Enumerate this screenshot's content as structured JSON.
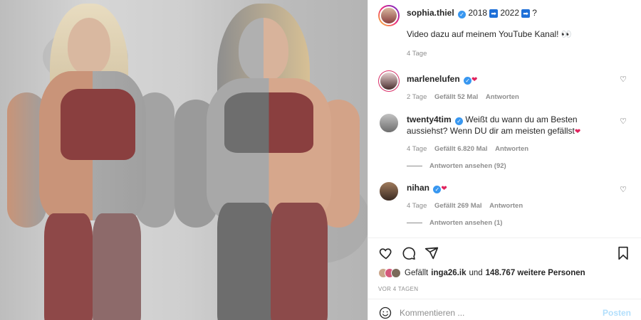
{
  "post": {
    "author": "sophia.thiel",
    "caption_text_1": "2018",
    "caption_text_2": "2022",
    "caption_text_3": "?",
    "caption_arrow": "➡",
    "caption_line2": "Video dazu auf meinem YouTube Kanal! 👀",
    "age": "4 Tage"
  },
  "comments": [
    {
      "username": "marlenelufen",
      "text": "",
      "age": "2 Tage",
      "likes": "Gefällt 52 Mal",
      "reply_label": "Antworten",
      "view_replies": ""
    },
    {
      "username": "twenty4tim",
      "text": "Weißt du wann du am Besten aussiehst? Wenn DU dir am meisten gefällst",
      "age": "4 Tage",
      "likes": "Gefällt 6.820 Mal",
      "reply_label": "Antworten",
      "view_replies": "Antworten ansehen (92)"
    },
    {
      "username": "nihan",
      "text": "",
      "age": "4 Tage",
      "likes": "Gefällt 269 Mal",
      "reply_label": "Antworten",
      "view_replies": "Antworten ansehen (1)"
    }
  ],
  "likes": {
    "prefix": "Gefällt",
    "user": "inga26.ik",
    "connector": "und",
    "count_text": "148.767 weitere Personen"
  },
  "timestamp": "VOR 4 TAGEN",
  "composer": {
    "placeholder": "Kommentieren ...",
    "post_label": "Posten"
  },
  "icons": {
    "verified": "verified-badge-icon",
    "heart": "heart-icon",
    "comment": "comment-icon",
    "share": "share-icon",
    "save": "bookmark-icon",
    "emoji": "emoji-icon"
  },
  "colors": {
    "verified": "#3897f0",
    "muted": "#8e8e8e",
    "post_button": "#b2dffc",
    "top_color": "#8a3f3f"
  }
}
